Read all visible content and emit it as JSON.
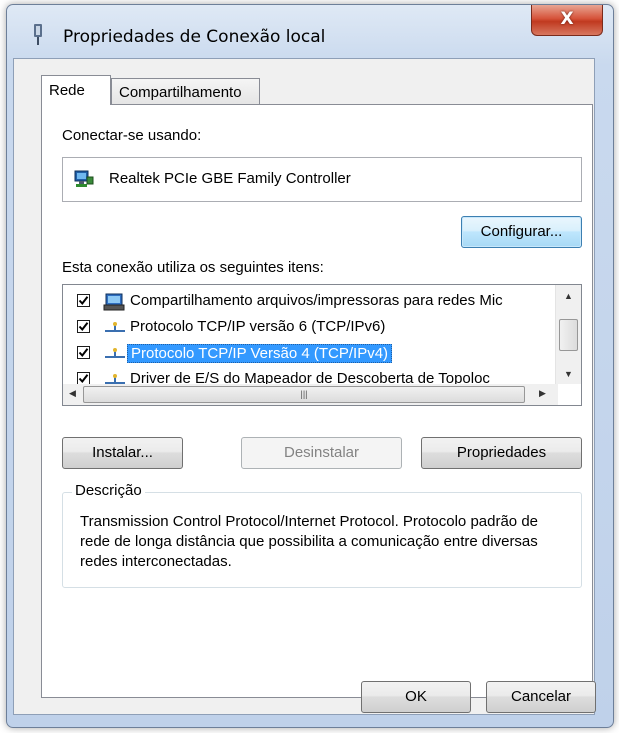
{
  "window": {
    "title": "Propriedades de Conexão local",
    "close_label": "X"
  },
  "tabs": [
    {
      "label": "Rede",
      "active": true
    },
    {
      "label": "Compartilhamento",
      "active": false
    }
  ],
  "connect_using": {
    "label": "Conectar-se usando:",
    "adapter": "Realtek PCIe GBE Family Controller",
    "adapter_icon": "network-adapter-icon"
  },
  "configure_button": "Configurar...",
  "items_label": "Esta conexão utiliza os seguintes itens:",
  "items": [
    {
      "label": "Compartilhamento arquivos/impressoras para redes Mic",
      "checked": true,
      "icon": "printer-share-icon",
      "selected": false
    },
    {
      "label": "Protocolo TCP/IP versão 6 (TCP/IPv6)",
      "checked": true,
      "icon": "protocol-icon",
      "selected": false
    },
    {
      "label": "Protocolo TCP/IP Versão 4 (TCP/IPv4)",
      "checked": true,
      "icon": "protocol-icon",
      "selected": true
    },
    {
      "label": "Driver de E/S do Mapeador de Descoberta de Topoloc",
      "checked": true,
      "icon": "protocol-icon",
      "selected": false
    }
  ],
  "buttons": {
    "install": "Instalar...",
    "uninstall": "Desinstalar",
    "properties": "Propriedades",
    "ok": "OK",
    "cancel": "Cancelar"
  },
  "description": {
    "legend": "Descrição",
    "text": "Transmission Control Protocol/Internet Protocol. Protocolo padrão de rede de longa distância que possibilita a comunicação entre diversas redes interconectadas."
  },
  "colors": {
    "selection": "#3399ff",
    "close_button": "#c7402a",
    "title_bar": "#c9d9ee"
  }
}
